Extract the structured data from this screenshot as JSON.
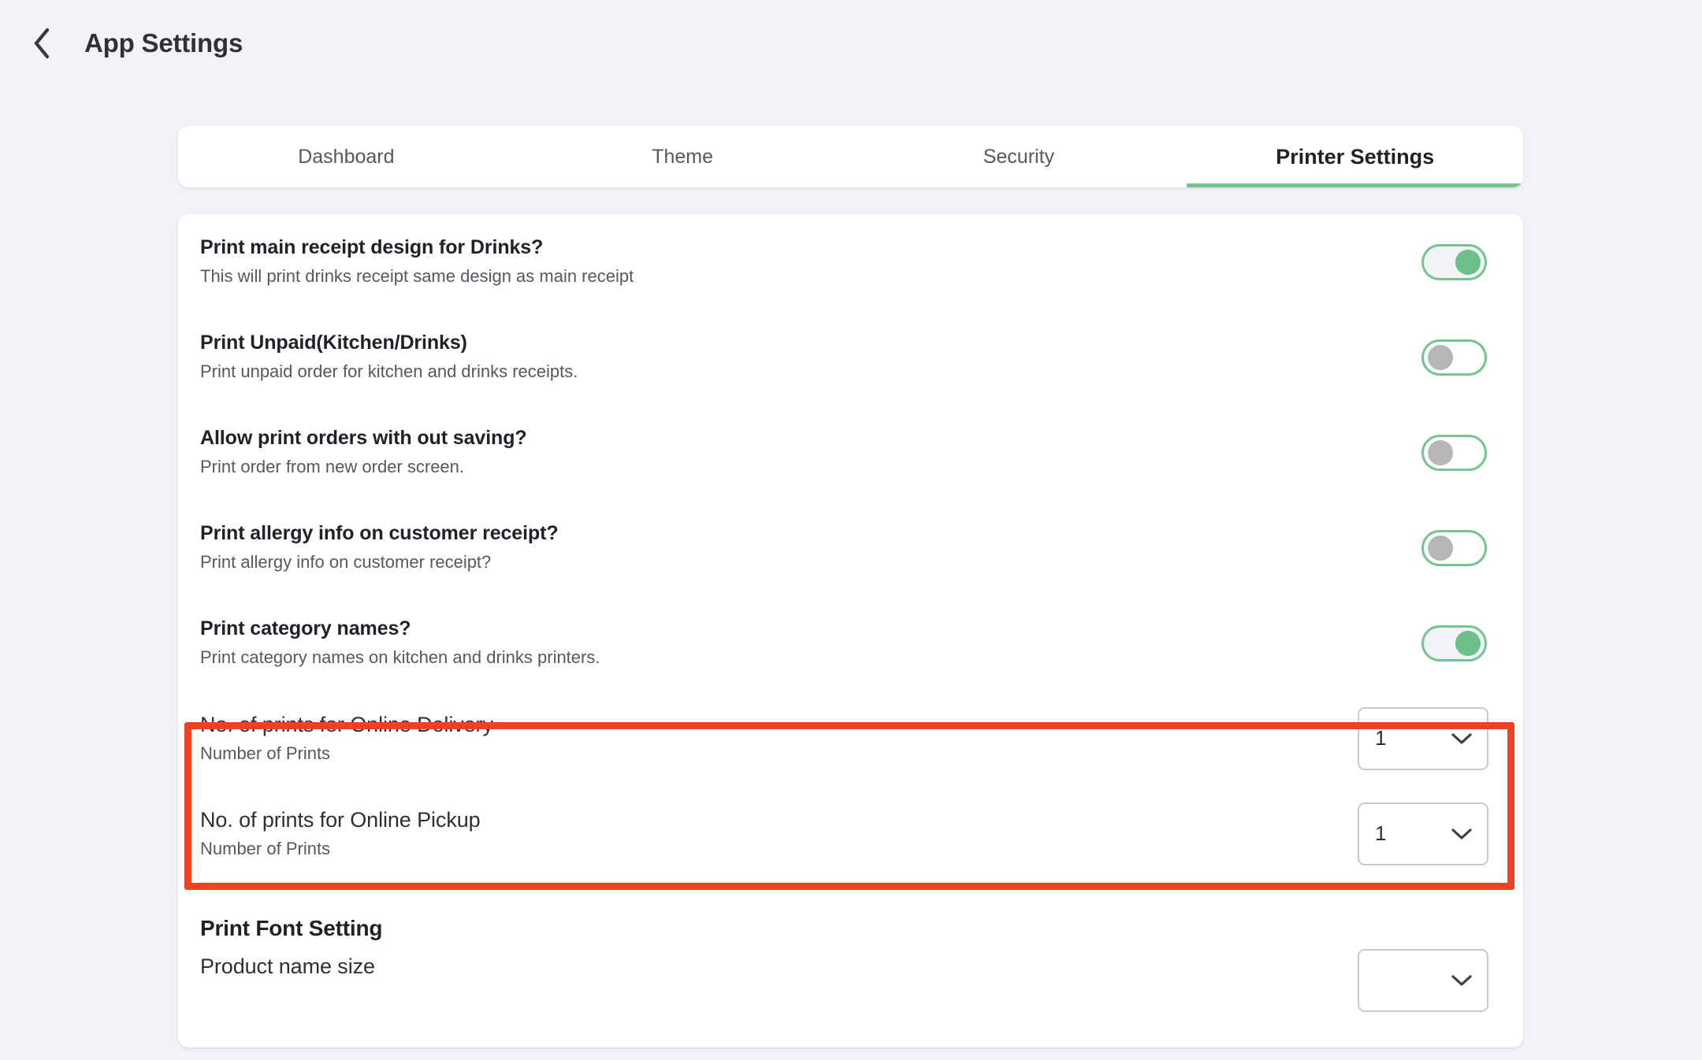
{
  "header": {
    "back_icon": "chevron-left-icon",
    "title": "App Settings"
  },
  "tabs": [
    {
      "label": "Dashboard",
      "active": false
    },
    {
      "label": "Theme",
      "active": false
    },
    {
      "label": "Security",
      "active": false
    },
    {
      "label": "Printer Settings",
      "active": true
    }
  ],
  "colors": {
    "accent_green": "#74c58f",
    "highlight_red": "#ee4323",
    "page_background": "#f1f3f7",
    "card_background": "#ffffff",
    "toggle_off_knob": "#b6b6b6"
  },
  "toggle_rows": [
    {
      "title": "Print main receipt design for Drinks?",
      "subtitle": "This will print drinks receipt same design as main receipt",
      "state": "on"
    },
    {
      "title": "Print Unpaid(Kitchen/Drinks)",
      "subtitle": "Print unpaid order for kitchen and drinks receipts.",
      "state": "off"
    },
    {
      "title": "Allow print orders with out saving?",
      "subtitle": "Print order from new order screen.",
      "state": "off"
    },
    {
      "title": "Print allergy info on customer receipt?",
      "subtitle": "Print allergy info on customer receipt?",
      "state": "off"
    },
    {
      "title": "Print category names?",
      "subtitle": "Print category names on kitchen and drinks printers.",
      "state": "on"
    }
  ],
  "highlighted_rows": [
    {
      "title": "No. of prints for Online Delivery",
      "subtitle": "Number of Prints",
      "value": "1",
      "dropdown_icon": "chevron-down-icon"
    },
    {
      "title": "No. of prints for Online Pickup",
      "subtitle": "Number of Prints",
      "value": "1",
      "dropdown_icon": "chevron-down-icon"
    }
  ],
  "font_section": {
    "heading": "Print Font Setting",
    "rows": [
      {
        "title": "Product name size",
        "value": "",
        "dropdown_icon": "chevron-down-icon"
      }
    ]
  }
}
